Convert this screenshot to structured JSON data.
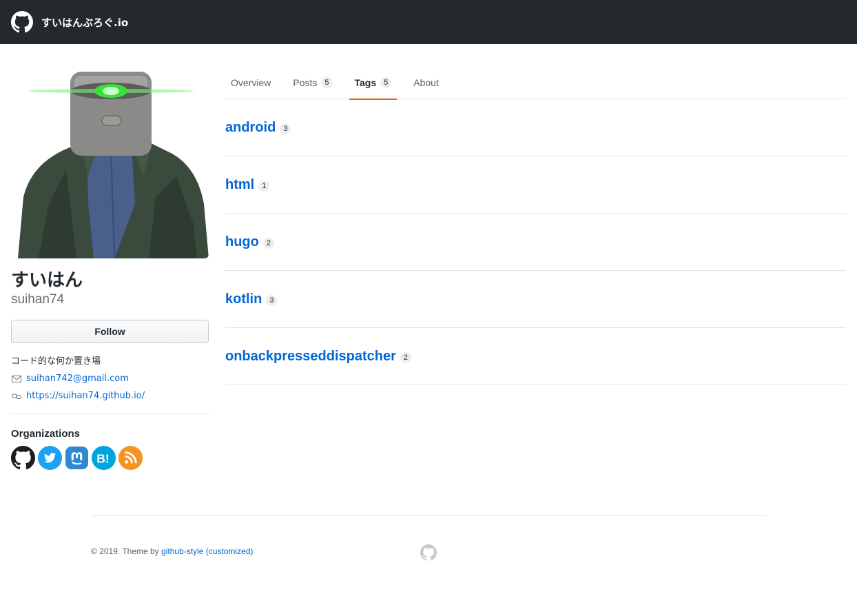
{
  "header": {
    "site_title": "すいはんぶろぐ.io",
    "logo_icon": "github-icon"
  },
  "profile": {
    "name": "すいはん",
    "login": "suihan74",
    "follow_label": "Follow",
    "bio": "コード的な何か置き場",
    "email": "suihan742@gmail.com",
    "website": "https://suihan74.github.io/",
    "organizations_title": "Organizations",
    "organizations": [
      {
        "icon": "github-icon",
        "color": "#1b1f23"
      },
      {
        "icon": "twitter-icon",
        "color": "#1da1f2"
      },
      {
        "icon": "mastodon-icon",
        "color": "#3088d4"
      },
      {
        "icon": "hatena-bookmark-icon",
        "color": "#00a4de"
      },
      {
        "icon": "rss-icon",
        "color": "#f7931e"
      }
    ]
  },
  "tabs": [
    {
      "label": "Overview",
      "count": null,
      "active": false
    },
    {
      "label": "Posts",
      "count": "5",
      "active": false
    },
    {
      "label": "Tags",
      "count": "5",
      "active": true
    },
    {
      "label": "About",
      "count": null,
      "active": false
    }
  ],
  "tags": [
    {
      "name": "android",
      "count": "3"
    },
    {
      "name": "html",
      "count": "1"
    },
    {
      "name": "hugo",
      "count": "2"
    },
    {
      "name": "kotlin",
      "count": "3"
    },
    {
      "name": "onbackpresseddispatcher",
      "count": "2"
    }
  ],
  "footer": {
    "prefix": "© 2019. Theme by ",
    "theme_link": "github-style",
    "customized_link": "(customized)"
  },
  "colors": {
    "header_bg": "#24292e",
    "link": "#0366d6",
    "active_tab": "#e36209"
  }
}
